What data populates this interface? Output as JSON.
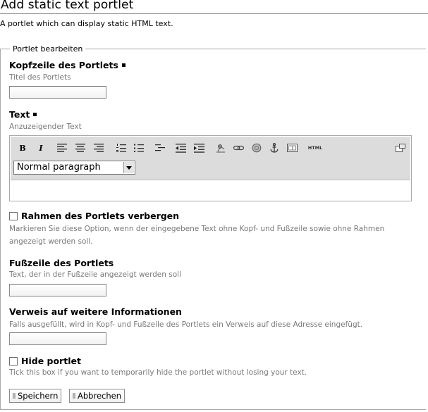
{
  "page": {
    "title": "Add static text portlet",
    "description": "A portlet which can display static HTML text."
  },
  "form": {
    "legend": "Portlet bearbeiten",
    "header_field": {
      "label": "Kopfzeile des Portlets",
      "help": "Titel des Portlets",
      "value": ""
    },
    "text_field": {
      "label": "Text",
      "help": "Anzuzeigender Text"
    },
    "omit_border": {
      "label": "Rahmen des Portlets verbergen",
      "help": "Markieren Sie diese Option, wenn der eingegebene Text ohne Kopf- und Fußzeile sowie ohne Rahmen angezeigt werden soll.",
      "checked": false
    },
    "footer_field": {
      "label": "Fußzeile des Portlets",
      "help": "Text, der in der Fußzeile angezeigt werden soll",
      "value": ""
    },
    "more_url_field": {
      "label": "Verweis auf weitere Informationen",
      "help": "Falls ausgefüllt, wird in Kopf- und Fußzeile des Portlets ein Verweis auf diese Adresse eingefügt.",
      "value": ""
    },
    "hide_portlet": {
      "label": "Hide portlet",
      "help": "Tick this box if you want to temporarily hide the portlet without losing your text.",
      "checked": false
    },
    "save_label": "Speichern",
    "cancel_label": "Abbrechen"
  },
  "editor": {
    "toolbar": {
      "bold": "B",
      "italic": "I",
      "html_label": "HTML",
      "icons": [
        "bold-icon",
        "italic-icon",
        "align-left-icon",
        "align-center-icon",
        "align-right-icon",
        "numbered-list-icon",
        "bullet-list-icon",
        "definition-list-icon",
        "outdent-icon",
        "indent-icon",
        "image-icon",
        "link-icon",
        "unlink-icon",
        "anchor-icon",
        "table-icon",
        "html-source-icon",
        "fullscreen-icon"
      ]
    },
    "format_select": {
      "selected": "Normal paragraph"
    }
  }
}
